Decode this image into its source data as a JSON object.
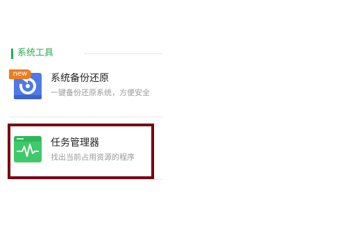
{
  "section": {
    "title": "系统工具"
  },
  "tools": [
    {
      "name": "系统备份还原",
      "description": "一键备份还原系统，方便安全",
      "badge": "new",
      "icon": "refresh-icon"
    },
    {
      "name": "任务管理器",
      "description": "找出当前占用资源的程序",
      "icon": "pulse-monitor-icon"
    }
  ],
  "colors": {
    "accent": "#22b04a",
    "badge": "#ef7d1e",
    "backup_icon": "#4f79e6",
    "taskmgr_icon": "#3ec96a",
    "highlight": "#7a0011"
  }
}
